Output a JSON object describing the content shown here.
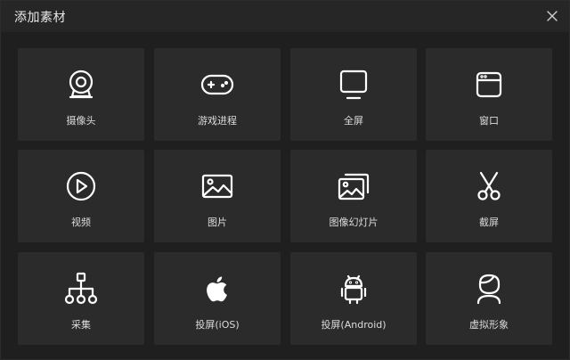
{
  "dialog": {
    "title": "添加素材",
    "close_icon": "close-icon"
  },
  "items": [
    {
      "label": "摄像头",
      "icon": "webcam-icon"
    },
    {
      "label": "游戏进程",
      "icon": "gamepad-icon"
    },
    {
      "label": "全屏",
      "icon": "monitor-icon"
    },
    {
      "label": "窗口",
      "icon": "window-icon"
    },
    {
      "label": "视频",
      "icon": "play-circle-icon"
    },
    {
      "label": "图片",
      "icon": "image-icon"
    },
    {
      "label": "图像幻灯片",
      "icon": "image-stack-icon"
    },
    {
      "label": "截屏",
      "icon": "scissors-icon"
    },
    {
      "label": "采集",
      "icon": "hierarchy-icon"
    },
    {
      "label": "投屏(iOS)",
      "icon": "apple-icon"
    },
    {
      "label": "投屏(Android)",
      "icon": "android-icon"
    },
    {
      "label": "虚拟形象",
      "icon": "avatar-icon"
    }
  ],
  "colors": {
    "background": "#1f1f1f",
    "card": "#2b2b2b",
    "text": "#dcdcdc",
    "icon_stroke": "#ffffff"
  }
}
